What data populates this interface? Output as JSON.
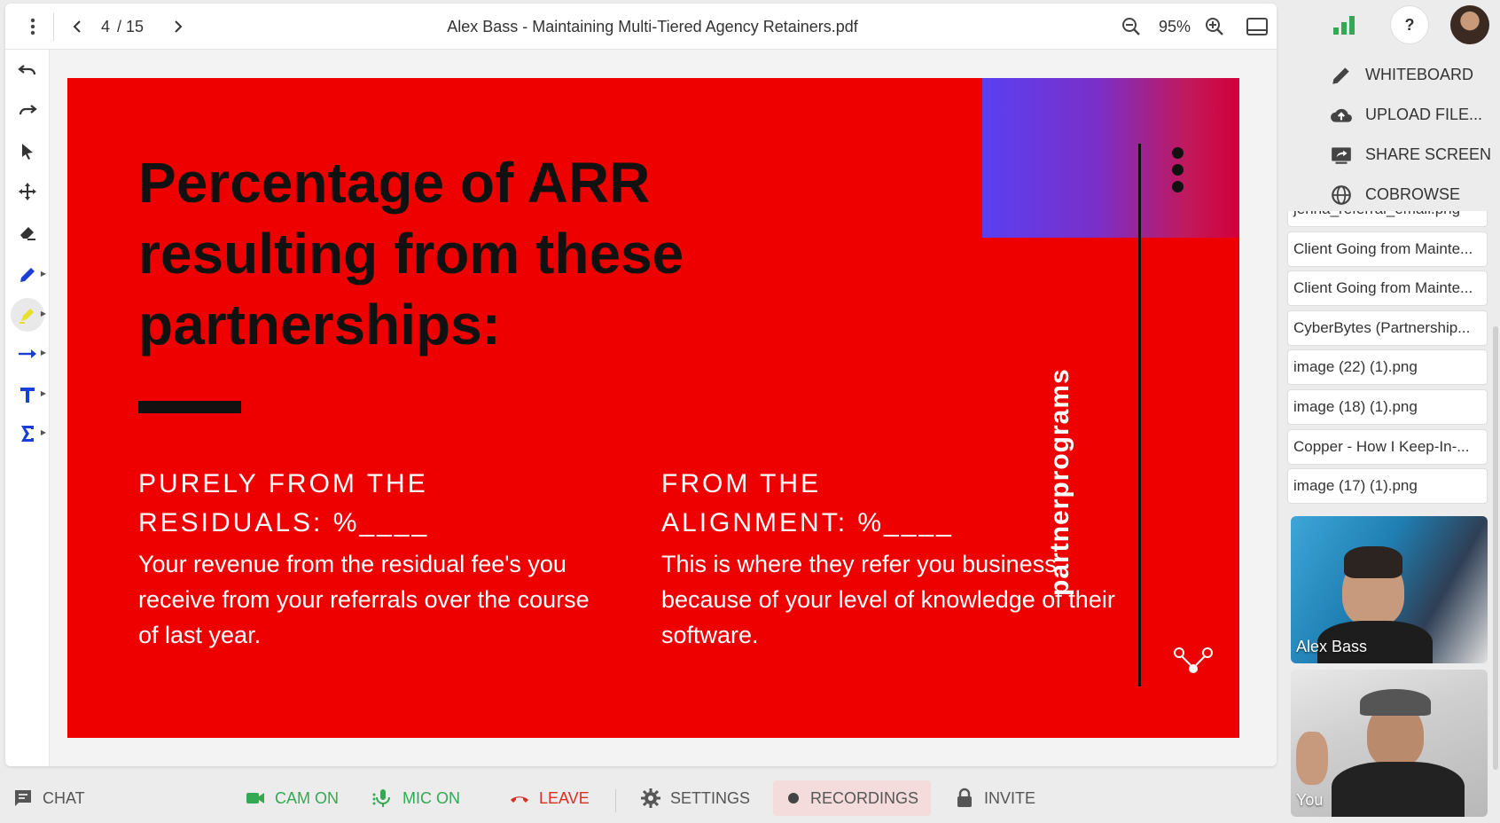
{
  "toolbar": {
    "page_current": "4",
    "page_total": "/ 15",
    "document_title": "Alex Bass - Maintaining Multi-Tiered Agency Retainers.pdf",
    "zoom": "95%"
  },
  "slide": {
    "title": "Percentage of ARR resulting from these partnerships:",
    "left_heading_line1": "PURELY FROM THE",
    "left_heading_line2": "RESIDUALS: %____",
    "left_body": "Your revenue from the residual fee's you receive from your referrals over the course of last year.",
    "right_heading_line1": "FROM THE",
    "right_heading_line2": "ALIGNMENT: %____",
    "right_body": "This is where they refer you business because of your level of knowledge of their software.",
    "brand": "partnerprograms"
  },
  "right_panel": {
    "help_label": "?",
    "actions": [
      {
        "label": "WHITEBOARD",
        "icon": "pencil-icon"
      },
      {
        "label": "UPLOAD FILE...",
        "icon": "cloud-upload-icon"
      },
      {
        "label": "SHARE SCREEN",
        "icon": "screen-share-icon"
      },
      {
        "label": "COBROWSE",
        "icon": "globe-icon"
      }
    ],
    "files": [
      "jenna_referral_email.png",
      "Client Going from Mainte...",
      "Client Going from Mainte...",
      "CyberBytes (Partnership...",
      "image (22) (1).png",
      "image (18) (1).png",
      "Copper - How I Keep-In-...",
      "image (17) (1).png"
    ],
    "videos": [
      {
        "name": "Alex Bass"
      },
      {
        "name": "You"
      }
    ]
  },
  "bottom_bar": {
    "chat": "CHAT",
    "cam": "CAM ON",
    "mic": "MIC ON",
    "leave": "LEAVE",
    "settings": "SETTINGS",
    "recordings": "RECORDINGS",
    "invite": "INVITE"
  },
  "colors": {
    "slide_background": "#ee0000",
    "accent_green": "#34a853",
    "leave_red": "#d93025"
  }
}
